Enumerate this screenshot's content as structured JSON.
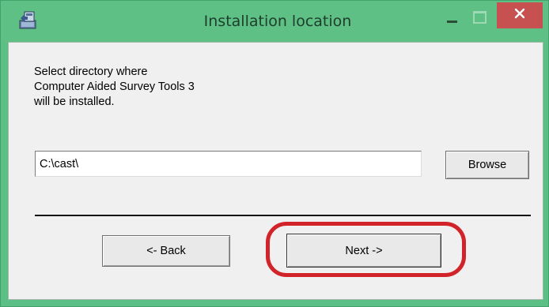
{
  "window": {
    "title": "Installation location",
    "icon": "installer-icon",
    "controls": {
      "minimize": "minimize-icon",
      "maximize": "maximize-icon",
      "close": "close-icon"
    }
  },
  "content": {
    "prompt": "Select directory where\nComputer Aided Survey Tools 3\nwill be installed.",
    "path_value": "C:\\cast\\",
    "browse_label": "Browse",
    "back_label": "<- Back",
    "next_label": "Next ->"
  },
  "colors": {
    "titlebar": "#5ec085",
    "close_button": "#c75050",
    "dialog_background": "#f0f0f0",
    "highlight": "#d2232a"
  }
}
